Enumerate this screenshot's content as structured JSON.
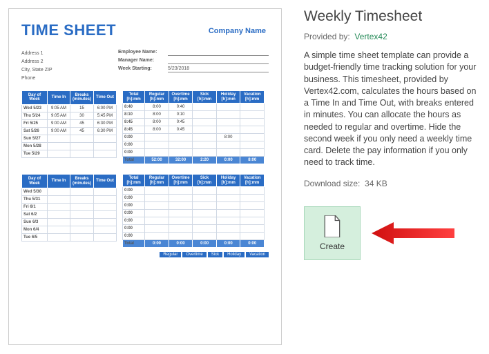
{
  "template": {
    "title": "Weekly Timesheet",
    "provided_by_label": "Provided by:",
    "provided_by": "Vertex42",
    "description": "A simple time sheet template can provide a budget-friendly time tracking solution for your business. This timesheet, provided by Vertex42.com, calculates the hours based on a Time In and Time Out, with breaks entered in minutes. You can allocate the hours as needed to regular and overtime. Hide the second week if you only need a weekly time card. Delete the pay information if you only need to track time.",
    "download_size_label": "Download size:",
    "download_size": "34 KB",
    "create_label": "Create"
  },
  "preview": {
    "sheet_title": "TIME SHEET",
    "company": "Company Name",
    "info": {
      "addr1": "Address 1",
      "addr2": "Address 2",
      "cityzip": "City, State  ZIP",
      "phone": "Phone",
      "emp_label": "Employee Name:",
      "mgr_label": "Manager Name:",
      "ws_label": "Week Starting:",
      "ws_value": "5/23/2018"
    },
    "headersA": [
      "Day of Week",
      "Time In",
      "Breaks (minutes)",
      "Time Out"
    ],
    "headersB": [
      "Total [h]:mm",
      "Regular [h]:mm",
      "Overtime [h]:mm",
      "Sick [h]:mm",
      "Holiday [h]:mm",
      "Vacation [h]:mm"
    ],
    "week1_days": [
      {
        "day": "Wed 5/23",
        "in": "9:05 AM",
        "brk": "15",
        "out": "6:00 PM",
        "tot": "8:40",
        "reg": "8:00",
        "ot": "0:40",
        "sick": "",
        "hol": "",
        "vac": ""
      },
      {
        "day": "Thu 5/24",
        "in": "9:05 AM",
        "brk": "30",
        "out": "5:45 PM",
        "tot": "8:10",
        "reg": "8:00",
        "ot": "0:10",
        "sick": "",
        "hol": "",
        "vac": ""
      },
      {
        "day": "Fri 5/25",
        "in": "9:00 AM",
        "brk": "45",
        "out": "6:30 PM",
        "tot": "8:45",
        "reg": "8:00",
        "ot": "0:45",
        "sick": "",
        "hol": "",
        "vac": ""
      },
      {
        "day": "Sat 5/26",
        "in": "9:00 AM",
        "brk": "45",
        "out": "6:30 PM",
        "tot": "8:45",
        "reg": "8:00",
        "ot": "0:45",
        "sick": "",
        "hol": "",
        "vac": ""
      },
      {
        "day": "Sun 5/27",
        "in": "",
        "brk": "",
        "out": "",
        "tot": "0:00",
        "reg": "",
        "ot": "",
        "sick": "",
        "hol": "8:00",
        "vac": ""
      },
      {
        "day": "Mon 5/28",
        "in": "",
        "brk": "",
        "out": "",
        "tot": "0:00",
        "reg": "",
        "ot": "",
        "sick": "",
        "hol": "",
        "vac": ""
      },
      {
        "day": "Tue 5/29",
        "in": "",
        "brk": "",
        "out": "",
        "tot": "0:00",
        "reg": "",
        "ot": "",
        "sick": "",
        "hol": "",
        "vac": ""
      }
    ],
    "week1_total": {
      "label": "Total",
      "tot": "52:00",
      "reg": "32:00",
      "ot": "2:20",
      "sick": "0:00",
      "hol": "8:00",
      "vac": "0:00"
    },
    "week2_days": [
      {
        "day": "Wed 5/30"
      },
      {
        "day": "Thu 5/31"
      },
      {
        "day": "Fri 6/1"
      },
      {
        "day": "Sat 6/2"
      },
      {
        "day": "Sun 6/3"
      },
      {
        "day": "Mon 6/4"
      },
      {
        "day": "Tue 6/5"
      }
    ],
    "week2_total": {
      "label": "Total",
      "tot": "0:00",
      "reg": "0:00",
      "ot": "0:00",
      "sick": "0:00",
      "hol": "0:00",
      "vac": "0:00"
    },
    "legend": [
      "Regular",
      "Overtime",
      "Sick",
      "Holiday",
      "Vacation"
    ]
  }
}
